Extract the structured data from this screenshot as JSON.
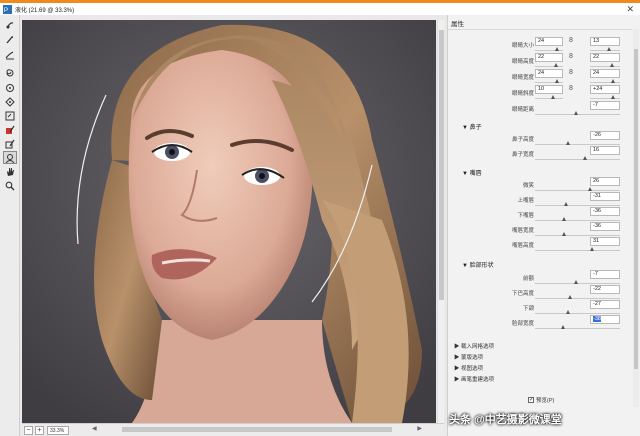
{
  "window": {
    "title": "液化 (21.69 @ 33.3%)",
    "close_glyph": "✕",
    "accent_color": "#f08a1c"
  },
  "tools": [
    {
      "icon": "forward-warp-icon"
    },
    {
      "icon": "reconstruct-icon"
    },
    {
      "icon": "smooth-icon"
    },
    {
      "icon": "twirl-icon"
    },
    {
      "icon": "pucker-icon"
    },
    {
      "icon": "bloat-icon"
    },
    {
      "icon": "push-left-icon"
    },
    {
      "icon": "freeze-mask-icon"
    },
    {
      "icon": "thaw-mask-icon"
    },
    {
      "icon": "face-tool-icon"
    },
    {
      "icon": "hand-icon"
    },
    {
      "icon": "zoom-icon"
    }
  ],
  "status": {
    "zoom": "33.3%",
    "zoom_out": "−",
    "zoom_in": "+"
  },
  "panel": {
    "header": "属性",
    "eyes": {
      "rows": [
        {
          "label": "眼睛大小",
          "left": "24",
          "right": "13"
        },
        {
          "label": "眼睛高度",
          "left": "22",
          "right": "22"
        },
        {
          "label": "眼睛宽度",
          "left": "24",
          "right": "24"
        },
        {
          "label": "眼睛斜度",
          "left": "10",
          "right": "+24"
        }
      ],
      "distance": {
        "label": "眼睛距离",
        "value": "-7"
      },
      "link_glyph": "8"
    },
    "nose": {
      "title": "鼻子",
      "rows": [
        {
          "label": "鼻子高度",
          "value": "-26"
        },
        {
          "label": "鼻子宽度",
          "value": "16"
        }
      ]
    },
    "mouth": {
      "title": "嘴唇",
      "rows": [
        {
          "label": "微笑",
          "value": "26"
        },
        {
          "label": "上嘴唇",
          "value": "-31"
        },
        {
          "label": "下嘴唇",
          "value": "-36"
        },
        {
          "label": "嘴唇宽度",
          "value": "-36"
        },
        {
          "label": "嘴唇高度",
          "value": "31"
        }
      ]
    },
    "face": {
      "title": "脸部形状",
      "rows": [
        {
          "label": "前额",
          "value": "-7"
        },
        {
          "label": "下巴高度",
          "value": "-22"
        },
        {
          "label": "下颌",
          "value": "-27"
        },
        {
          "label": "脸部宽度",
          "value": "-38"
        }
      ]
    },
    "collapsed": [
      "载入网格选项",
      "蒙版选项",
      "视图选项",
      "画笔重建选项"
    ],
    "preview_label": "预览(P)",
    "preview_checked": "✓"
  },
  "watermark": "头条 @中艺摄影微课堂"
}
